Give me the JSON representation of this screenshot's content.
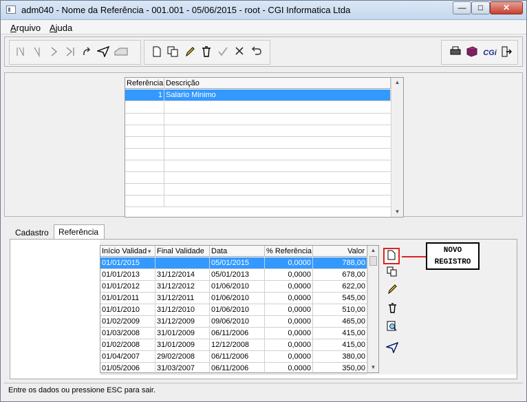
{
  "window": {
    "title": "adm040 - Nome da Referência - 001.001 - 05/06/2015 - root - CGI Informatica Ltda",
    "min_glyph": "—",
    "max_glyph": "□",
    "close_glyph": "✕"
  },
  "menu": {
    "arquivo": "Arquivo",
    "ajuda": "Ajuda"
  },
  "toolbar": {
    "icons": [
      "first-icon",
      "prev-icon",
      "next-icon",
      "last-icon",
      "refresh-icon",
      "send-icon",
      "mail-icon",
      "new-doc-icon",
      "copy-icon",
      "edit-icon",
      "delete-icon",
      "confirm-icon",
      "cancel-icon",
      "undo-icon",
      "print-icon",
      "book-icon",
      "cgi-logo-icon",
      "exit-icon"
    ],
    "cgi_text": "CGi"
  },
  "ref_grid": {
    "columns": [
      "Referência",
      "Descrição"
    ],
    "rows": [
      {
        "ref": "1",
        "desc": "Salario Minimo"
      }
    ]
  },
  "tabs": {
    "cadastro": "Cadastro",
    "referencia": "Referência"
  },
  "values_grid": {
    "columns": [
      "Início Validad",
      "Final Validade",
      "Data",
      "% Referência",
      "Valor"
    ],
    "rows": [
      {
        "inicio": "01/01/2015",
        "final": "",
        "data": "05/01/2015",
        "perc": "0,0000",
        "valor": "788,00"
      },
      {
        "inicio": "01/01/2013",
        "final": "31/12/2014",
        "data": "05/01/2013",
        "perc": "0,0000",
        "valor": "678,00"
      },
      {
        "inicio": "01/01/2012",
        "final": "31/12/2012",
        "data": "01/06/2010",
        "perc": "0,0000",
        "valor": "622,00"
      },
      {
        "inicio": "01/01/2011",
        "final": "31/12/2011",
        "data": "01/06/2010",
        "perc": "0,0000",
        "valor": "545,00"
      },
      {
        "inicio": "01/01/2010",
        "final": "31/12/2010",
        "data": "01/06/2010",
        "perc": "0,0000",
        "valor": "510,00"
      },
      {
        "inicio": "01/02/2009",
        "final": "31/12/2009",
        "data": "09/06/2010",
        "perc": "0,0000",
        "valor": "465,00"
      },
      {
        "inicio": "01/03/2008",
        "final": "31/01/2009",
        "data": "06/11/2006",
        "perc": "0,0000",
        "valor": "415,00"
      },
      {
        "inicio": "01/02/2008",
        "final": "31/01/2009",
        "data": "12/12/2008",
        "perc": "0,0000",
        "valor": "415,00"
      },
      {
        "inicio": "01/04/2007",
        "final": "29/02/2008",
        "data": "06/11/2006",
        "perc": "0,0000",
        "valor": "380,00"
      },
      {
        "inicio": "01/05/2006",
        "final": "31/03/2007",
        "data": "06/11/2006",
        "perc": "0,0000",
        "valor": "350,00"
      }
    ]
  },
  "side_buttons": [
    "new-record-icon",
    "copy-record-icon",
    "edit-record-icon",
    "delete-record-icon",
    "search-record-icon",
    "send-record-icon"
  ],
  "callout": {
    "line1": "NOVO",
    "line2": "REGISTRO"
  },
  "status": {
    "text": "Entre os dados ou pressione ESC para sair."
  }
}
